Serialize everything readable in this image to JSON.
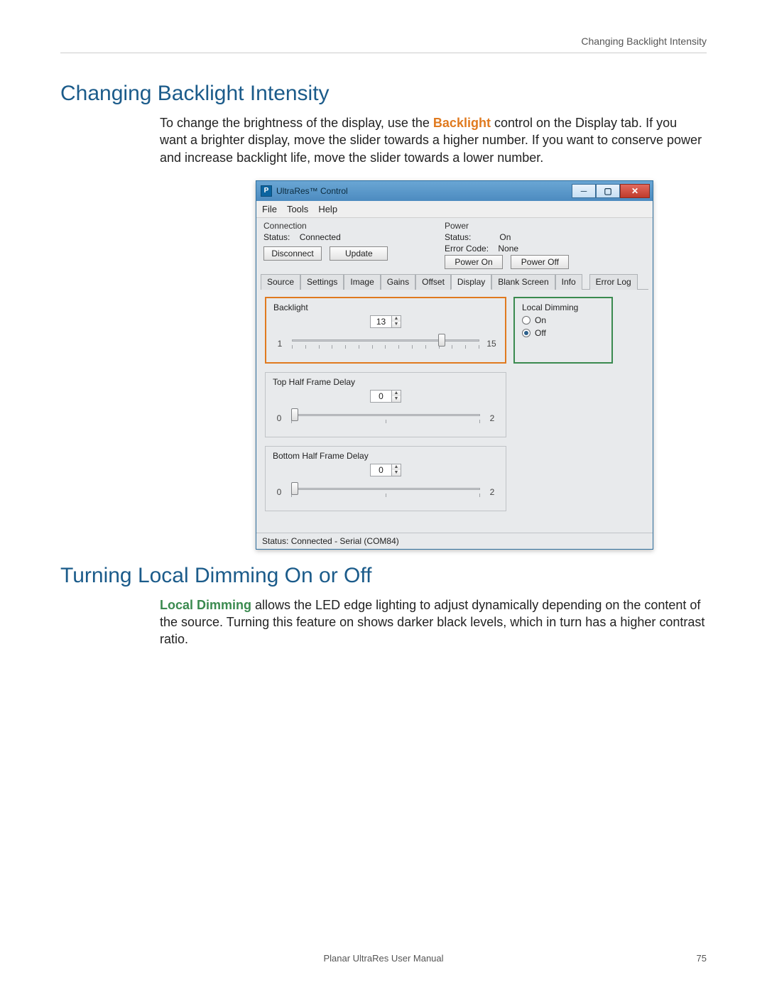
{
  "header": {
    "running": "Changing Backlight Intensity"
  },
  "section1": {
    "title": "Changing Backlight Intensity",
    "para_pre": "To change the brightness of the display, use the ",
    "para_hl": "Backlight",
    "para_post": " control on the Display tab. If you want a brighter display, move the slider towards a higher number. If you want to conserve power and increase backlight life, move the slider towards a lower number."
  },
  "app": {
    "title": "UltraRes™ Control",
    "icon_letter": "P",
    "menu": {
      "file": "File",
      "tools": "Tools",
      "help": "Help"
    },
    "connection": {
      "heading": "Connection",
      "status_label": "Status:",
      "status_value": "Connected",
      "btn_disconnect": "Disconnect",
      "btn_update": "Update"
    },
    "power": {
      "heading": "Power",
      "status_label": "Status:",
      "status_value": "On",
      "error_label": "Error Code:",
      "error_value": "None",
      "btn_on": "Power On",
      "btn_off": "Power Off"
    },
    "tabs": {
      "source": "Source",
      "settings": "Settings",
      "image": "Image",
      "gains": "Gains",
      "offset": "Offset",
      "display": "Display",
      "blank": "Blank Screen",
      "info": "Info",
      "error": "Error Log"
    },
    "display_tab": {
      "backlight": {
        "legend": "Backlight",
        "value": "13",
        "min": "1",
        "max": "15"
      },
      "local_dimming": {
        "legend": "Local Dimming",
        "on": "On",
        "off": "Off"
      },
      "top_delay": {
        "legend": "Top Half Frame Delay",
        "value": "0",
        "min": "0",
        "max": "2"
      },
      "bottom_delay": {
        "legend": "Bottom Half Frame Delay",
        "value": "0",
        "min": "0",
        "max": "2"
      }
    },
    "statusbar": "Status: Connected - Serial (COM84)"
  },
  "section2": {
    "title": "Turning Local Dimming On or Off",
    "para_hl": "Local Dimming",
    "para_post": " allows the LED edge lighting to adjust dynamically depending on the content of the source. Turning this feature on shows darker black levels, which in turn has a higher contrast ratio."
  },
  "footer": {
    "center": "Planar UltraRes User Manual",
    "page": "75"
  }
}
